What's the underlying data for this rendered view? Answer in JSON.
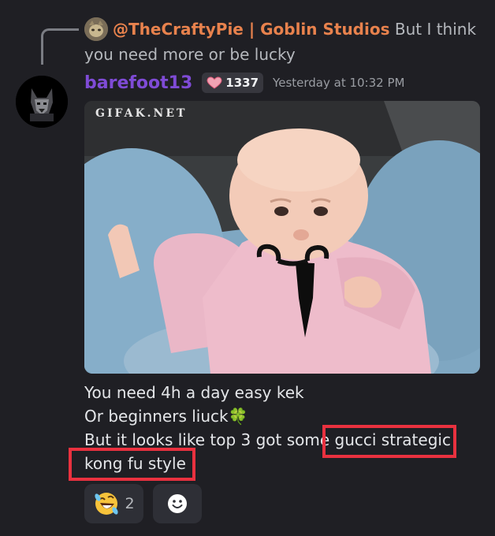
{
  "reply": {
    "author": "@TheCraftyPie | Goblin Studios",
    "text": "But I think you need more or be lucky"
  },
  "message": {
    "username": "barefoot13",
    "level_badge": "1337",
    "timestamp": "Yesterday at 10:32 PM",
    "gif_watermark": "GIFAK.NET",
    "lines": [
      "You need 4h a day easy kek",
      "Or beginners liuck",
      "But it looks like top 3 got some ",
      "kong fu style"
    ],
    "line3_highlighted": "gucci strategic",
    "clover": "🍀"
  },
  "reactions": {
    "emoji": "🤣",
    "count": "2",
    "add_reaction_icon": "smiley-icon"
  },
  "colors": {
    "background": "#1f1f24",
    "username": "#7f4bd6",
    "reply_author": "#e8824d",
    "highlight": "#e9313f"
  }
}
